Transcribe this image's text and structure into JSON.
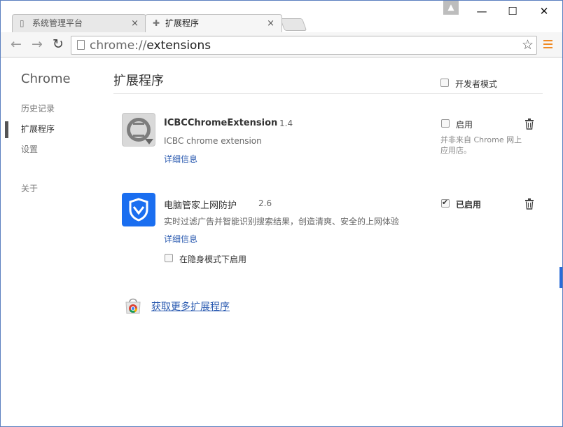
{
  "tabs": [
    {
      "label": "系统管理平台",
      "close": "×"
    },
    {
      "label": "扩展程序",
      "close": "×"
    }
  ],
  "window_controls": {
    "minimize": "—",
    "maximize": "☐",
    "close": "✕"
  },
  "toolbar": {
    "back": "←",
    "forward": "→",
    "reload": "↻",
    "url_scheme": "chrome://",
    "url_host": "extensions",
    "star": "☆"
  },
  "sidebar": {
    "title": "Chrome",
    "items": [
      {
        "label": "历史记录"
      },
      {
        "label": "扩展程序"
      },
      {
        "label": "设置"
      },
      {
        "label": "关于"
      }
    ]
  },
  "main": {
    "title": "扩展程序",
    "developer_mode_label": "开发者模式",
    "developer_mode_checked": false
  },
  "extensions": [
    {
      "name": "ICBCChromeExtension",
      "version": "1.4",
      "description": "ICBC chrome extension",
      "details_link": "详细信息",
      "enable_label": "启用",
      "enabled": false,
      "note": "并非来自 Chrome 网上应用店。"
    },
    {
      "name": "电脑管家上网防护",
      "version": "2.6",
      "description": "实时过滤广告并智能识别搜索结果，创造清爽、安全的上网体验",
      "details_link": "详细信息",
      "enable_label": "已启用",
      "enabled": true,
      "incognito_label": "在隐身模式下启用",
      "incognito_checked": false
    }
  ],
  "store_link": "获取更多扩展程序",
  "colors": {
    "accent": "#2a5ab0",
    "tencent_blue": "#1a6ef0",
    "menu_orange": "#f08a24"
  }
}
